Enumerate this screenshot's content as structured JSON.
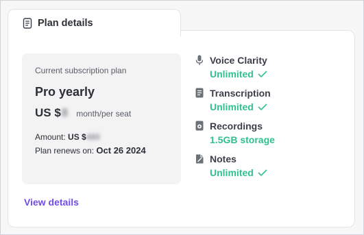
{
  "tab": {
    "title": "Plan details",
    "icon": "document-list-icon"
  },
  "plan": {
    "label": "Current subscription plan",
    "name": "Pro yearly",
    "price_prefix": "US $",
    "price_value": "8",
    "price_suffix": "month/per seat",
    "amount_label": "Amount:",
    "amount_prefix": "US $",
    "amount_value": "480",
    "renew_label": "Plan renews on:",
    "renew_date": "Oct 26 2024"
  },
  "link": {
    "view_details": "View details"
  },
  "features": [
    {
      "name": "Voice Clarity",
      "value": "Unlimited",
      "icon": "microphone-icon",
      "checked": true
    },
    {
      "name": "Transcription",
      "value": "Unlimited",
      "icon": "transcript-icon",
      "checked": true
    },
    {
      "name": "Recordings",
      "value": "1.5GB storage",
      "icon": "recordings-icon",
      "checked": false
    },
    {
      "name": "Notes",
      "value": "Unlimited",
      "icon": "notes-icon",
      "checked": true
    }
  ],
  "colors": {
    "accent_link": "#6f4de8",
    "accent_green": "#2fbf91",
    "card_bg": "#f3f3f4",
    "icon_gray": "#6b7079"
  }
}
